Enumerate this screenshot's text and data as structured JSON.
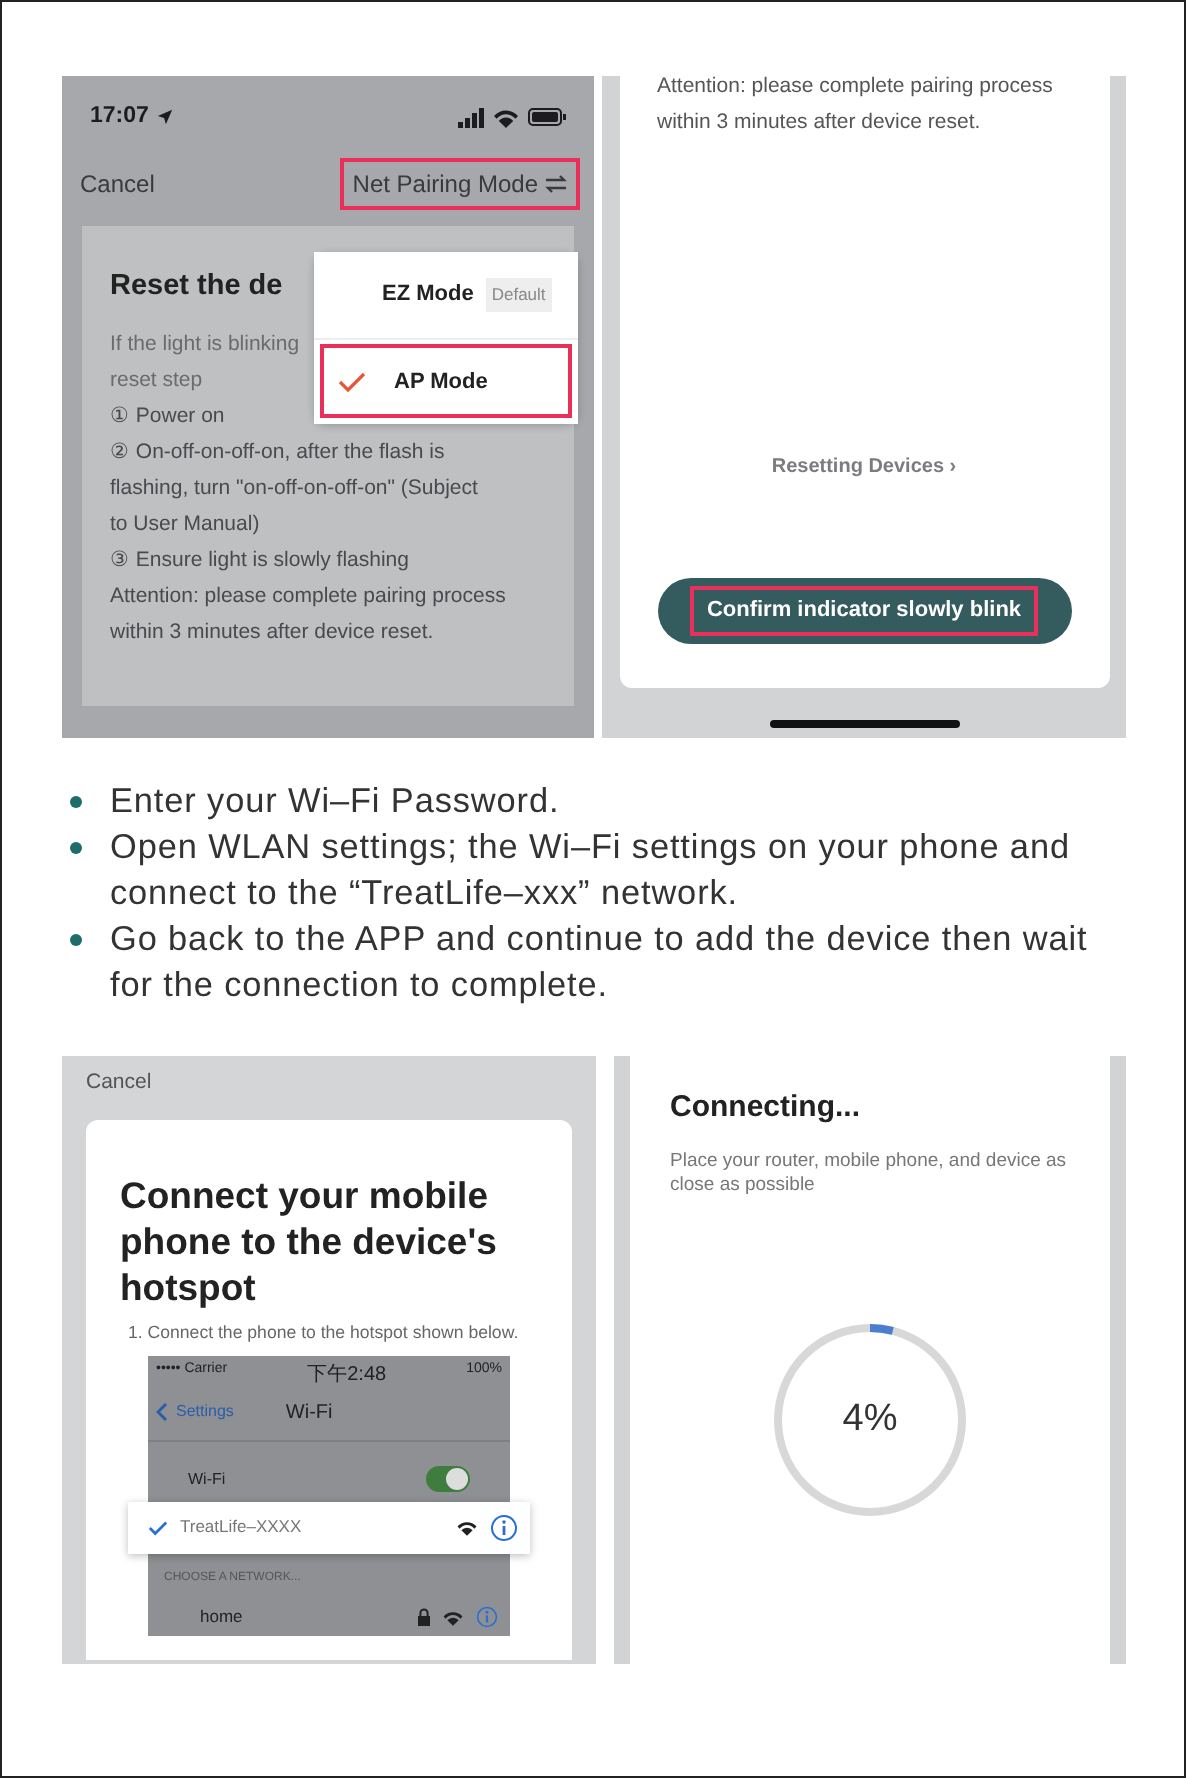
{
  "pairing_screen": {
    "status_time": "17:07",
    "cancel": "Cancel",
    "mode_button": {
      "label": "Net Pairing Mode",
      "highlighted": true
    },
    "card_title": "Reset the de",
    "card_lines": [
      "If the light is blinking",
      "reset step",
      "① Power on",
      "② On-off-on-off-on, after the flash is",
      "flashing, turn \"on-off-on-off-on\" (Subject",
      "to User Manual)",
      "③ Ensure light is slowly flashing",
      "Attention: please complete pairing process",
      "within 3 minutes after device reset."
    ],
    "menu": [
      {
        "label": "EZ Mode",
        "badge": "Default",
        "selected": false,
        "highlighted": false
      },
      {
        "label": "AP Mode",
        "selected": true,
        "highlighted": true
      }
    ]
  },
  "reset_screen": {
    "lines": [
      "Attention: please complete pairing process",
      "within 3 minutes after device reset."
    ],
    "link": "Resetting Devices ›",
    "confirm_button": {
      "label": "Confirm indicator slowly blink",
      "highlighted": true
    }
  },
  "instructions": [
    "Enter your Wi–Fi Password.",
    "Open WLAN settings; the Wi–Fi settings on your phone and connect to the “TreatLife–xxx” network.",
    "Go back to the APP and continue to add the device then wait for the connection to complete."
  ],
  "hotspot_screen": {
    "cancel": "Cancel",
    "title": "Connect your mobile phone to the device's hotspot",
    "step": "1. Connect the phone to the hotspot shown below.",
    "wifi_shot": {
      "carrier": "••••• Carrier",
      "time": "下午2:48",
      "battery": "100%",
      "back": "Settings",
      "title": "Wi-Fi",
      "toggle": {
        "label": "Wi-Fi",
        "on": true
      },
      "section": "CHOOSE A NETWORK...",
      "networks": [
        {
          "name": "TreatLife–XXXX",
          "selected": true,
          "locked": false
        },
        {
          "name": "home",
          "selected": false,
          "locked": true
        }
      ]
    }
  },
  "connecting_screen": {
    "title": "Connecting...",
    "hint": "Place your router, mobile phone, and device as close as possible",
    "progress": {
      "level": 0.04,
      "reading": "4%"
    }
  }
}
